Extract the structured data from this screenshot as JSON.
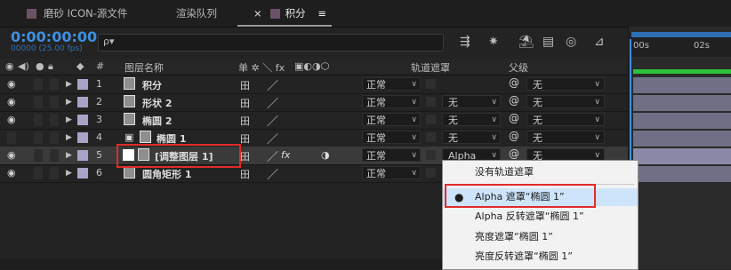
{
  "tabs": [
    {
      "label": "磨砂 ICON-源文件",
      "active": false
    },
    {
      "label": "渲染队列",
      "active": false
    },
    {
      "label": "积分",
      "active": true
    }
  ],
  "tab_close": "×",
  "tab_menu": "≡",
  "timecode": "0:00:00:00",
  "fps": "00000 (25.00 fps)",
  "search_icon": "ρ▾",
  "headers": {
    "layer_name": "图层名称",
    "num": "#",
    "track_matte": "轨道遮罩",
    "parent": "父级",
    "switches": "单 ✲ ＼ fx"
  },
  "ruler": {
    "start": "00s",
    "mark": "02s"
  },
  "layers": [
    {
      "num": "1",
      "name": "积分",
      "mode": "正常",
      "track": "",
      "parent": "无"
    },
    {
      "num": "2",
      "name": "形状 2",
      "mode": "正常",
      "track": "无",
      "parent": "无"
    },
    {
      "num": "3",
      "name": "椭圆 2",
      "mode": "正常",
      "track": "无",
      "parent": "无"
    },
    {
      "num": "4",
      "name": "椭圆 1",
      "mode": "正常",
      "track": "无",
      "parent": "无"
    },
    {
      "num": "5",
      "name": "[调整图层 1]",
      "mode": "正常",
      "track": "Alpha",
      "parent": "无"
    },
    {
      "num": "6",
      "name": "圆角矩形 1",
      "mode": "正常",
      "track": "",
      "parent": "无"
    }
  ],
  "popup": {
    "items": [
      "没有轨道遮罩",
      "Alpha 遮罩“椭圆 1”",
      "Alpha 反转遮罩“椭圆 1”",
      "亮度遮罩“椭圆 1”",
      "亮度反转遮罩“椭圆 1”"
    ],
    "checked_index": 1
  },
  "colors": {
    "accent": "#3d8fe0",
    "label": "#a9a3c8",
    "highlight": "#e32a2a"
  }
}
